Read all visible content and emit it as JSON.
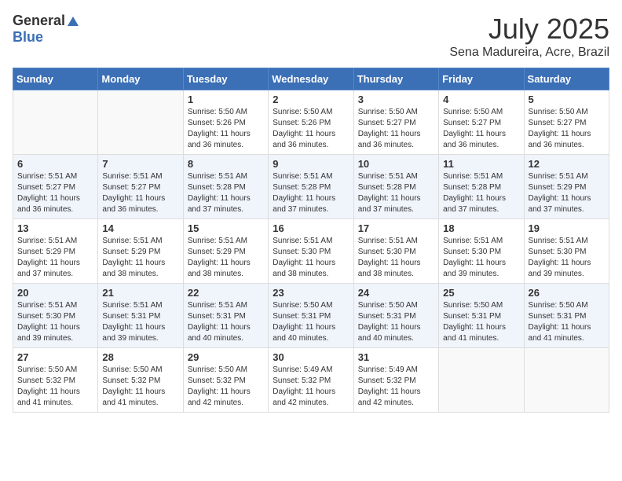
{
  "header": {
    "logo_general": "General",
    "logo_blue": "Blue",
    "month_year": "July 2025",
    "location": "Sena Madureira, Acre, Brazil"
  },
  "weekdays": [
    "Sunday",
    "Monday",
    "Tuesday",
    "Wednesday",
    "Thursday",
    "Friday",
    "Saturday"
  ],
  "weeks": [
    [
      {
        "day": "",
        "sunrise": "",
        "sunset": "",
        "daylight": ""
      },
      {
        "day": "",
        "sunrise": "",
        "sunset": "",
        "daylight": ""
      },
      {
        "day": "1",
        "sunrise": "Sunrise: 5:50 AM",
        "sunset": "Sunset: 5:26 PM",
        "daylight": "Daylight: 11 hours and 36 minutes."
      },
      {
        "day": "2",
        "sunrise": "Sunrise: 5:50 AM",
        "sunset": "Sunset: 5:26 PM",
        "daylight": "Daylight: 11 hours and 36 minutes."
      },
      {
        "day": "3",
        "sunrise": "Sunrise: 5:50 AM",
        "sunset": "Sunset: 5:27 PM",
        "daylight": "Daylight: 11 hours and 36 minutes."
      },
      {
        "day": "4",
        "sunrise": "Sunrise: 5:50 AM",
        "sunset": "Sunset: 5:27 PM",
        "daylight": "Daylight: 11 hours and 36 minutes."
      },
      {
        "day": "5",
        "sunrise": "Sunrise: 5:50 AM",
        "sunset": "Sunset: 5:27 PM",
        "daylight": "Daylight: 11 hours and 36 minutes."
      }
    ],
    [
      {
        "day": "6",
        "sunrise": "Sunrise: 5:51 AM",
        "sunset": "Sunset: 5:27 PM",
        "daylight": "Daylight: 11 hours and 36 minutes."
      },
      {
        "day": "7",
        "sunrise": "Sunrise: 5:51 AM",
        "sunset": "Sunset: 5:27 PM",
        "daylight": "Daylight: 11 hours and 36 minutes."
      },
      {
        "day": "8",
        "sunrise": "Sunrise: 5:51 AM",
        "sunset": "Sunset: 5:28 PM",
        "daylight": "Daylight: 11 hours and 37 minutes."
      },
      {
        "day": "9",
        "sunrise": "Sunrise: 5:51 AM",
        "sunset": "Sunset: 5:28 PM",
        "daylight": "Daylight: 11 hours and 37 minutes."
      },
      {
        "day": "10",
        "sunrise": "Sunrise: 5:51 AM",
        "sunset": "Sunset: 5:28 PM",
        "daylight": "Daylight: 11 hours and 37 minutes."
      },
      {
        "day": "11",
        "sunrise": "Sunrise: 5:51 AM",
        "sunset": "Sunset: 5:28 PM",
        "daylight": "Daylight: 11 hours and 37 minutes."
      },
      {
        "day": "12",
        "sunrise": "Sunrise: 5:51 AM",
        "sunset": "Sunset: 5:29 PM",
        "daylight": "Daylight: 11 hours and 37 minutes."
      }
    ],
    [
      {
        "day": "13",
        "sunrise": "Sunrise: 5:51 AM",
        "sunset": "Sunset: 5:29 PM",
        "daylight": "Daylight: 11 hours and 37 minutes."
      },
      {
        "day": "14",
        "sunrise": "Sunrise: 5:51 AM",
        "sunset": "Sunset: 5:29 PM",
        "daylight": "Daylight: 11 hours and 38 minutes."
      },
      {
        "day": "15",
        "sunrise": "Sunrise: 5:51 AM",
        "sunset": "Sunset: 5:29 PM",
        "daylight": "Daylight: 11 hours and 38 minutes."
      },
      {
        "day": "16",
        "sunrise": "Sunrise: 5:51 AM",
        "sunset": "Sunset: 5:30 PM",
        "daylight": "Daylight: 11 hours and 38 minutes."
      },
      {
        "day": "17",
        "sunrise": "Sunrise: 5:51 AM",
        "sunset": "Sunset: 5:30 PM",
        "daylight": "Daylight: 11 hours and 38 minutes."
      },
      {
        "day": "18",
        "sunrise": "Sunrise: 5:51 AM",
        "sunset": "Sunset: 5:30 PM",
        "daylight": "Daylight: 11 hours and 39 minutes."
      },
      {
        "day": "19",
        "sunrise": "Sunrise: 5:51 AM",
        "sunset": "Sunset: 5:30 PM",
        "daylight": "Daylight: 11 hours and 39 minutes."
      }
    ],
    [
      {
        "day": "20",
        "sunrise": "Sunrise: 5:51 AM",
        "sunset": "Sunset: 5:30 PM",
        "daylight": "Daylight: 11 hours and 39 minutes."
      },
      {
        "day": "21",
        "sunrise": "Sunrise: 5:51 AM",
        "sunset": "Sunset: 5:31 PM",
        "daylight": "Daylight: 11 hours and 39 minutes."
      },
      {
        "day": "22",
        "sunrise": "Sunrise: 5:51 AM",
        "sunset": "Sunset: 5:31 PM",
        "daylight": "Daylight: 11 hours and 40 minutes."
      },
      {
        "day": "23",
        "sunrise": "Sunrise: 5:50 AM",
        "sunset": "Sunset: 5:31 PM",
        "daylight": "Daylight: 11 hours and 40 minutes."
      },
      {
        "day": "24",
        "sunrise": "Sunrise: 5:50 AM",
        "sunset": "Sunset: 5:31 PM",
        "daylight": "Daylight: 11 hours and 40 minutes."
      },
      {
        "day": "25",
        "sunrise": "Sunrise: 5:50 AM",
        "sunset": "Sunset: 5:31 PM",
        "daylight": "Daylight: 11 hours and 41 minutes."
      },
      {
        "day": "26",
        "sunrise": "Sunrise: 5:50 AM",
        "sunset": "Sunset: 5:31 PM",
        "daylight": "Daylight: 11 hours and 41 minutes."
      }
    ],
    [
      {
        "day": "27",
        "sunrise": "Sunrise: 5:50 AM",
        "sunset": "Sunset: 5:32 PM",
        "daylight": "Daylight: 11 hours and 41 minutes."
      },
      {
        "day": "28",
        "sunrise": "Sunrise: 5:50 AM",
        "sunset": "Sunset: 5:32 PM",
        "daylight": "Daylight: 11 hours and 41 minutes."
      },
      {
        "day": "29",
        "sunrise": "Sunrise: 5:50 AM",
        "sunset": "Sunset: 5:32 PM",
        "daylight": "Daylight: 11 hours and 42 minutes."
      },
      {
        "day": "30",
        "sunrise": "Sunrise: 5:49 AM",
        "sunset": "Sunset: 5:32 PM",
        "daylight": "Daylight: 11 hours and 42 minutes."
      },
      {
        "day": "31",
        "sunrise": "Sunrise: 5:49 AM",
        "sunset": "Sunset: 5:32 PM",
        "daylight": "Daylight: 11 hours and 42 minutes."
      },
      {
        "day": "",
        "sunrise": "",
        "sunset": "",
        "daylight": ""
      },
      {
        "day": "",
        "sunrise": "",
        "sunset": "",
        "daylight": ""
      }
    ]
  ]
}
